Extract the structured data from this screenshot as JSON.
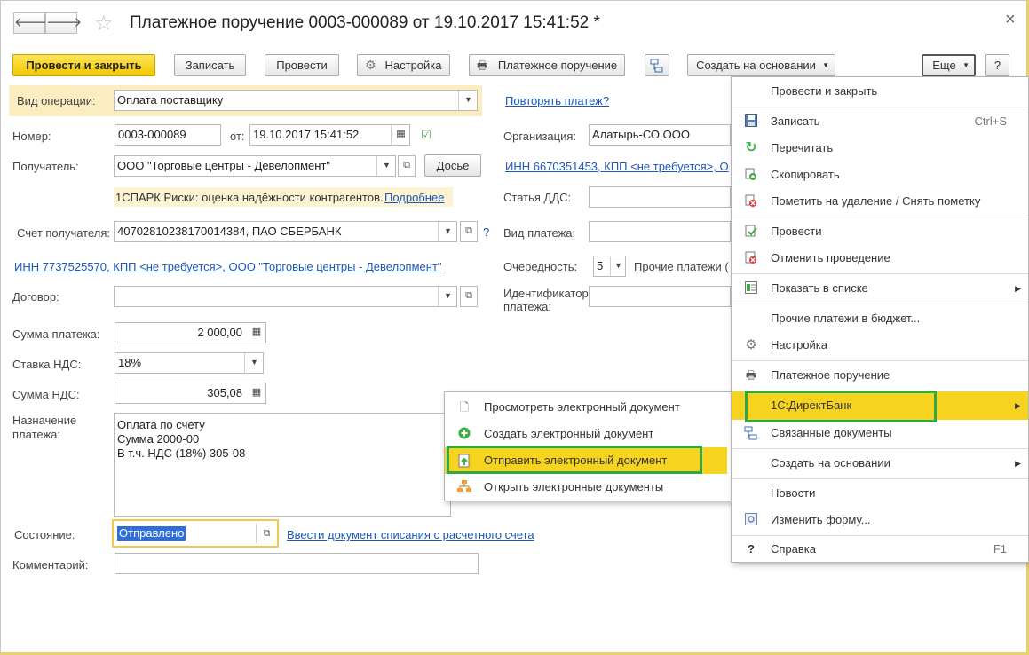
{
  "window": {
    "title": "Платежное поручение 0003-000089 от 19.10.2017 15:41:52 *",
    "back": "🡐",
    "forward": "🡒",
    "star": "☆",
    "close": "×"
  },
  "toolbar": {
    "post_close": "Провести и закрыть",
    "save": "Записать",
    "post": "Провести",
    "settings": "Настройка",
    "payment_order": "Платежное поручение",
    "create_based": "Создать на основании",
    "more": "Еще",
    "help": "?"
  },
  "form": {
    "op_type_label": "Вид операции:",
    "op_type_value": "Оплата поставщику",
    "repeat_link": "Повторять платеж?",
    "number_label": "Номер:",
    "number_value": "0003-000089",
    "date_label": "от:",
    "date_value": "19.10.2017 15:41:52",
    "org_label": "Организация:",
    "org_value": "Алатырь-СО ООО",
    "recipient_label": "Получатель:",
    "recipient_value": "ООО \"Торговые центры - Девелопмент\"",
    "dossier_button": "Досье",
    "org_inn_link": "ИНН 6670351453, КПП <не требуется>, О",
    "spark_text": "1СПАРК Риски: оценка надёжности контрагентов.",
    "spark_link": "Подробнее",
    "dds_label": "Статья ДДС:",
    "account_label": "Счет получателя:",
    "account_value": "40702810238170014384, ПАО СБЕРБАНК",
    "help_mark": "?",
    "pay_type_label": "Вид платежа:",
    "recipient_inn_link": "ИНН 7737525570, КПП <не требуется>, ООО \"Торговые центры - Девелопмент\"",
    "priority_label": "Очередность:",
    "priority_value": "5",
    "budget_text": "Прочие платежи (",
    "contract_label": "Договор:",
    "identifier_label_1": "Идентификатор",
    "identifier_label_2": "платежа:",
    "amount_label": "Сумма платежа:",
    "amount_value": "2 000,00",
    "vat_rate_label": "Ставка НДС:",
    "vat_rate_value": "18%",
    "vat_amount_label": "Сумма НДС:",
    "vat_amount_value": "305,08",
    "purpose_label_1": "Назначение",
    "purpose_label_2": "платежа:",
    "purpose_line_1": "Оплата по счету",
    "purpose_line_2": "Сумма 2000-00",
    "purpose_line_3": "В т.ч. НДС  (18%) 305-08",
    "state_label": "Состояние:",
    "state_value": "Отправлено",
    "state_link": "Ввести документ списания с расчетного счета",
    "comment_label": "Комментарий:"
  },
  "more_menu": {
    "items": [
      {
        "label": "Провести и закрыть",
        "icon": ""
      },
      {
        "label": "Записать",
        "icon": "save-icon",
        "shortcut": "Ctrl+S"
      },
      {
        "label": "Перечитать",
        "icon": "refresh-icon"
      },
      {
        "label": "Скопировать",
        "icon": "copy-icon"
      },
      {
        "label": "Пометить на удаление / Снять пометку",
        "icon": "delete-mark-icon"
      },
      {
        "label": "Провести",
        "icon": "post-icon"
      },
      {
        "label": "Отменить проведение",
        "icon": "unpost-icon"
      },
      {
        "label": "Показать в списке",
        "icon": "list-icon"
      },
      {
        "label": "Прочие платежи в бюджет...",
        "icon": ""
      },
      {
        "label": "Настройка",
        "icon": "gear-icon"
      },
      {
        "label": "Платежное поручение",
        "icon": "printer-icon"
      },
      {
        "label": "1С:ДиректБанк",
        "icon": ""
      },
      {
        "label": "Связанные документы",
        "icon": "structure-icon"
      },
      {
        "label": "Создать на основании",
        "icon": ""
      },
      {
        "label": "Новости",
        "icon": ""
      },
      {
        "label": "Изменить форму...",
        "icon": "form-icon"
      },
      {
        "label": "Справка",
        "icon": "help-icon",
        "shortcut": "F1"
      }
    ]
  },
  "submenu": {
    "items": [
      {
        "label": "Просмотреть электронный документ",
        "icon": "document-icon"
      },
      {
        "label": "Создать электронный документ",
        "icon": "plus-circle-icon"
      },
      {
        "label": "Отправить электронный документ",
        "icon": "send-document-icon"
      },
      {
        "label": "Открыть электронные документы",
        "icon": "documents-tree-icon"
      }
    ]
  },
  "colors": {
    "accent_yellow": "#f5d31e",
    "highlight_green": "#2ea84a",
    "link_blue": "#1d57b8"
  }
}
